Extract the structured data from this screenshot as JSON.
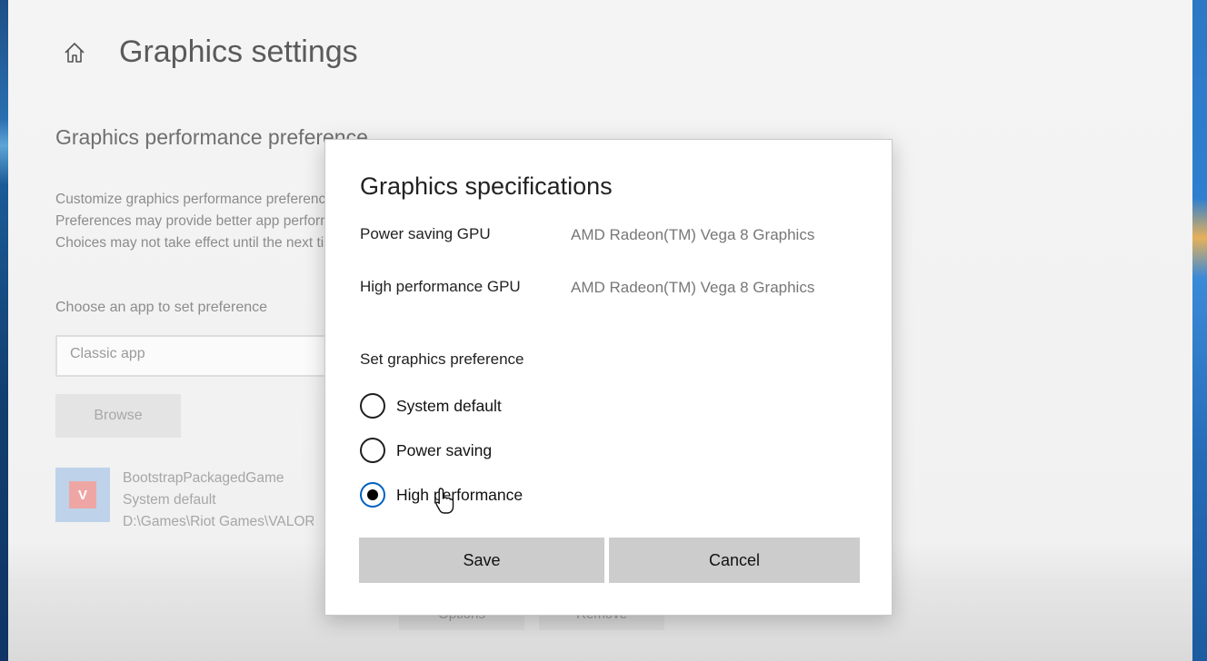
{
  "page": {
    "title": "Graphics settings",
    "section_title": "Graphics performance preference",
    "description_lines": [
      "Customize graphics performance preference for specific applications.",
      "Preferences may provide better app performance or save battery life.",
      "Choices may not take effect until the next time the app launches."
    ],
    "choose_label": "Choose an app to set preference",
    "app_type_value": "Classic app",
    "browse_label": "Browse",
    "app": {
      "name": "BootstrapPackagedGame",
      "preference": "System default",
      "path": "D:\\Games\\Riot Games\\VALORANT"
    },
    "options_label": "Options",
    "remove_label": "Remove"
  },
  "dialog": {
    "title": "Graphics specifications",
    "specs": [
      {
        "label": "Power saving GPU",
        "value": "AMD Radeon(TM) Vega 8 Graphics"
      },
      {
        "label": "High performance GPU",
        "value": "AMD Radeon(TM) Vega 8 Graphics"
      }
    ],
    "pref_label": "Set graphics preference",
    "options": [
      {
        "label": "System default",
        "checked": false
      },
      {
        "label": "Power saving",
        "checked": false
      },
      {
        "label": "High performance",
        "checked": true
      }
    ],
    "save_label": "Save",
    "cancel_label": "Cancel"
  },
  "colors": {
    "radio_accent": "#0060c0",
    "button_gray": "#cccccc"
  },
  "icons": [
    "home-icon",
    "valorant-app-icon",
    "mouse-cursor-icon"
  ]
}
